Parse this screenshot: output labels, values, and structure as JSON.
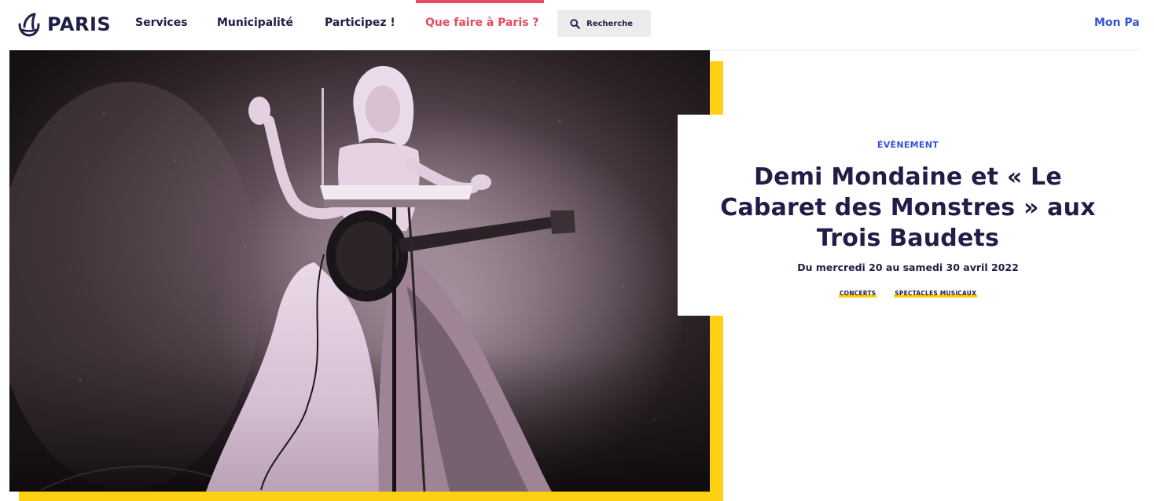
{
  "header": {
    "logo_text": "PARIS",
    "nav": [
      {
        "label": "Services"
      },
      {
        "label": "Municipalité"
      },
      {
        "label": "Participez !"
      },
      {
        "label": "Que faire à Paris ?",
        "active": true
      }
    ],
    "search": {
      "placeholder": "Recherche",
      "icon": "search-icon"
    },
    "account_label": "Mon Pa"
  },
  "event": {
    "kicker": "ÉVÈNEMENT",
    "title_lines": [
      "Demi Mondaine et « Le",
      "Cabaret des Monstres » aux",
      "Trois Baudets"
    ],
    "dates": "Du mercredi 20 au samedi 30 avril 2022",
    "tags": [
      "CONCERTS",
      "SPECTACLES MUSICAUX"
    ]
  },
  "colors": {
    "navy": "#1e1e46",
    "accent_red": "#e84a5f",
    "blue": "#3652d9",
    "yellow": "#ffd012"
  }
}
